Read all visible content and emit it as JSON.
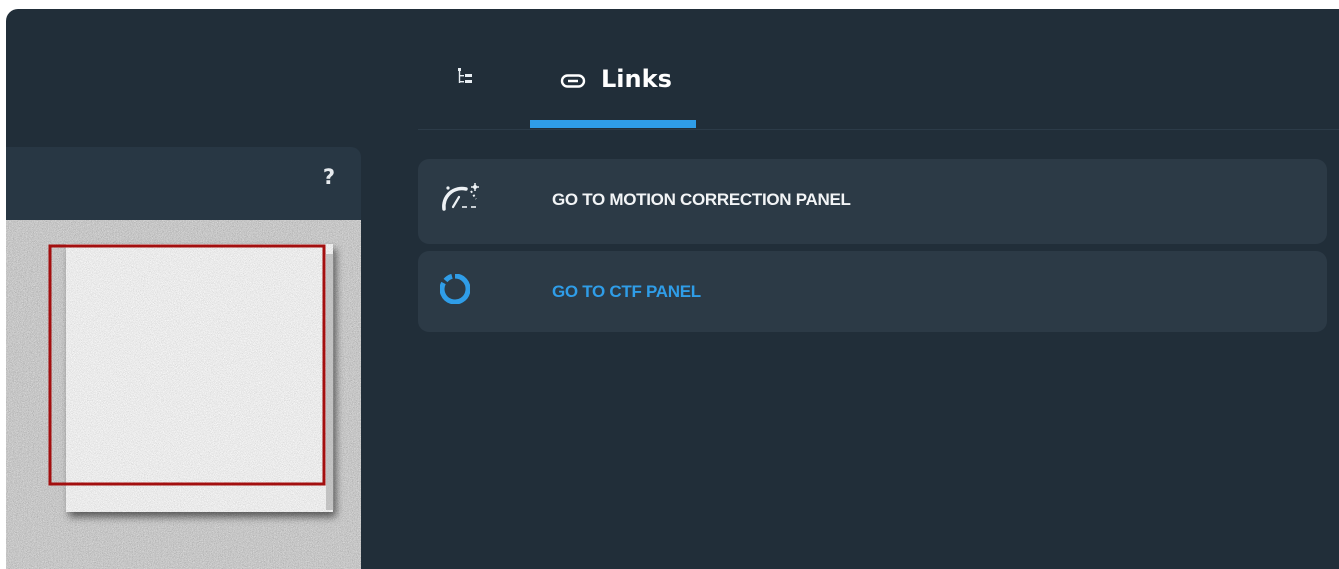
{
  "tabs": [
    {
      "label": "",
      "icon": "tree-icon",
      "active": false
    },
    {
      "label": "Links",
      "icon": "link-icon",
      "active": true
    }
  ],
  "image_panel": {
    "help_label": "?"
  },
  "links": [
    {
      "label": "GO TO MOTION CORRECTION PANEL",
      "icon": "speedometer-icon",
      "color": "#f2f4f6"
    },
    {
      "label": "GO TO CTF PANEL",
      "icon": "ring-icon",
      "color": "#2f9de8"
    }
  ],
  "colors": {
    "background": "#212e39",
    "card": "#2c3a46",
    "accent": "#2f9de8",
    "selection_box": "#a30f0f"
  }
}
